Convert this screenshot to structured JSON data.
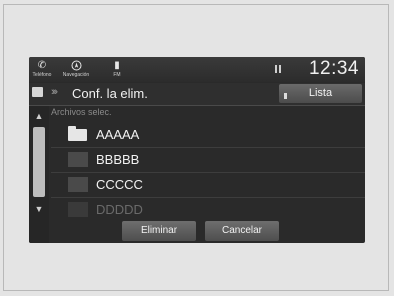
{
  "status_bar": {
    "phone_label": "Teléfono",
    "nav_label": "Navegación",
    "fm_label": "FM",
    "clock": "12:34"
  },
  "title_bar": {
    "title": "Conf. la elim.",
    "list_button": "Lista"
  },
  "list": {
    "header": "Archivos selec.",
    "items": [
      {
        "label": "AAAAA",
        "icon": "folder-icon"
      },
      {
        "label": "BBBBB",
        "icon": "file-thumbnail"
      },
      {
        "label": "CCCCC",
        "icon": "file-thumbnail"
      },
      {
        "label": "DDDDD",
        "icon": "file-thumbnail"
      }
    ]
  },
  "actions": {
    "delete_label": "Eliminar",
    "cancel_label": "Cancelar"
  }
}
